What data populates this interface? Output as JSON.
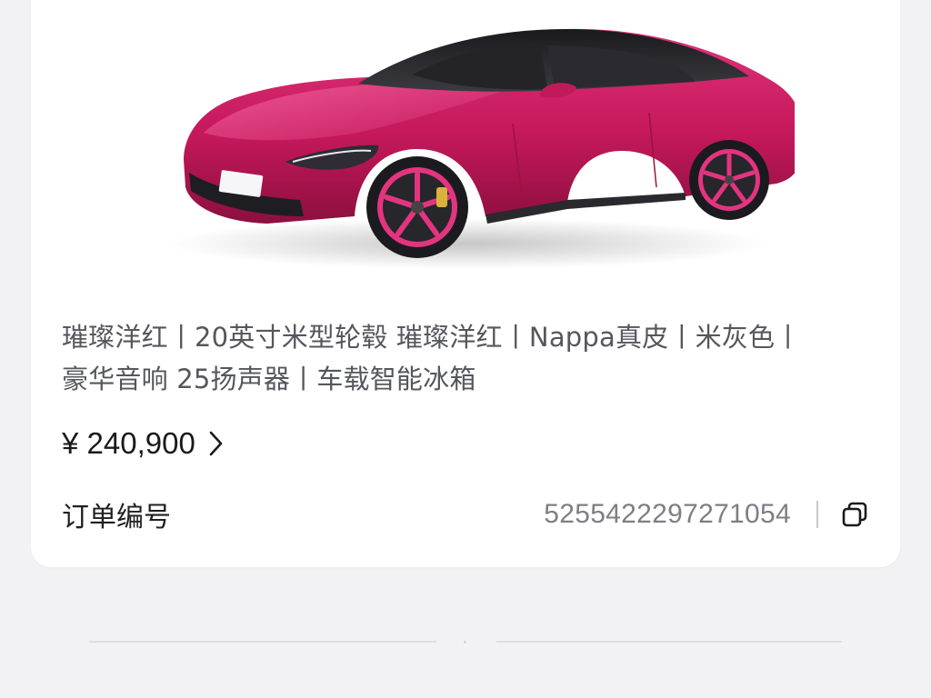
{
  "order_card": {
    "car_image": "car-image",
    "config_line_1": "璀璨洋红丨20英寸米型轮毂 璀璨洋红丨Nappa真皮丨米灰色丨",
    "config_line_2": "豪华音响 25扬声器丨车载智能冰箱",
    "price": "¥ 240,900",
    "price_icon": "chevron-right-icon",
    "order_number_label": "订单编号",
    "order_number_value": "5255422297271054",
    "copy_icon": "copy-icon"
  },
  "colors": {
    "car_body": "#c4185a",
    "background": "#f2f2f4",
    "card": "#ffffff"
  }
}
